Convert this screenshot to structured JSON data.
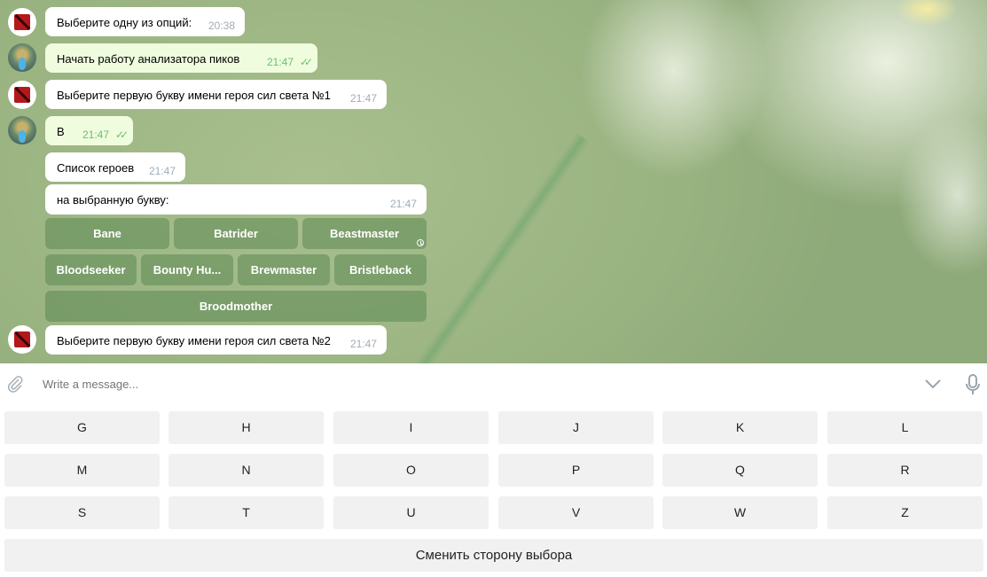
{
  "messages": [
    {
      "side": "in",
      "text": "Выберите одну из опций:",
      "time": "20:38"
    },
    {
      "side": "out",
      "text": "Начать работу анализатора пиков",
      "time": "21:47",
      "status": "read"
    },
    {
      "side": "in",
      "text": "Выберите первую букву имени героя сил света №1",
      "time": "21:47"
    },
    {
      "side": "out",
      "text": "B",
      "time": "21:47",
      "status": "read"
    },
    {
      "side": "in",
      "text": "Список героев",
      "time": "21:47"
    },
    {
      "side": "in",
      "text": "на выбранную букву:",
      "time": "21:47"
    },
    {
      "side": "in",
      "text": "Выберите первую букву имени героя сил света №2",
      "time": "21:47"
    }
  ],
  "inline_keyboard": {
    "rows": [
      [
        "Bane",
        "Batrider",
        "Beastmaster"
      ],
      [
        "Bloodseeker",
        "Bounty Hu...",
        "Brewmaster",
        "Bristleback"
      ],
      [
        "Broodmother"
      ]
    ]
  },
  "composer": {
    "placeholder": "Write a message...",
    "icons": {
      "attach": "paperclip-icon",
      "collapse": "chevron-down-icon",
      "voice": "microphone-icon"
    }
  },
  "reply_keyboard": {
    "rows": [
      [
        "G",
        "H",
        "I",
        "J",
        "K",
        "L"
      ],
      [
        "M",
        "N",
        "O",
        "P",
        "Q",
        "R"
      ],
      [
        "S",
        "T",
        "U",
        "V",
        "W",
        "Z"
      ]
    ],
    "wide_button": "Сменить сторону выбора"
  },
  "colors": {
    "incoming_bubble": "#ffffff",
    "outgoing_bubble": "#effdde",
    "read_check": "#6cbf6e",
    "inline_button": "#648e58",
    "reply_key": "#f1f1f1"
  }
}
